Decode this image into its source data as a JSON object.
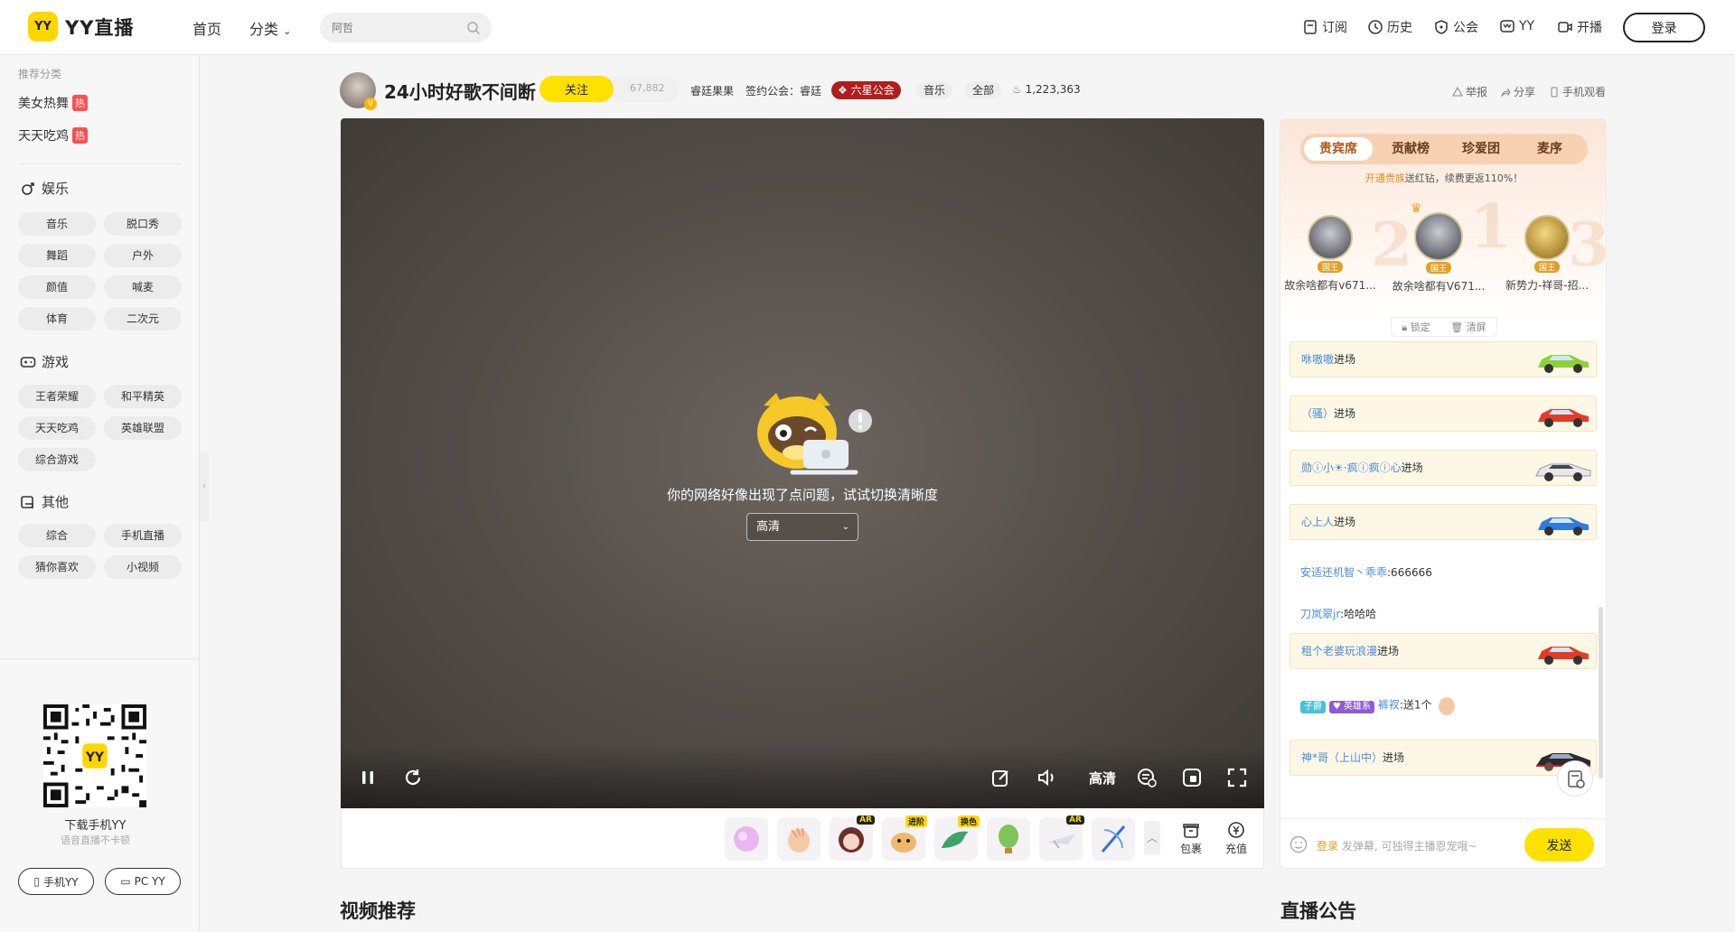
{
  "header": {
    "logo_badge": "YY",
    "logo_text": "YY直播",
    "nav": [
      "首页",
      "分类"
    ],
    "search_placeholder": "阿哲",
    "right_nav": [
      "订阅",
      "历史",
      "公会",
      "YY",
      "开播"
    ],
    "login_label": "登录"
  },
  "sidebar": {
    "recommend_title": "推荐分类",
    "hot_items": [
      {
        "label": "美女热舞",
        "badge": "热"
      },
      {
        "label": "天天吃鸡",
        "badge": "热"
      }
    ],
    "sections": [
      {
        "title": "娱乐",
        "icon": "female-symbol-icon",
        "items": [
          "音乐",
          "脱口秀",
          "舞蹈",
          "户外",
          "颜值",
          "喊麦",
          "体育",
          "二次元"
        ]
      },
      {
        "title": "游戏",
        "icon": "gamepad-icon",
        "items": [
          "王者荣耀",
          "和平精英",
          "天天吃鸡",
          "英雄联盟",
          "综合游戏"
        ]
      },
      {
        "title": "其他",
        "icon": "other-icon",
        "items": [
          "综合",
          "手机直播",
          "猜你喜欢",
          "小视频"
        ]
      }
    ],
    "download_title": "下载手机YY",
    "download_subtitle": "语音直播不卡顿",
    "app_buttons": [
      "手机YY",
      "PC YY"
    ],
    "qr_badge": "YY"
  },
  "room": {
    "title": "24小时好歌不间断",
    "follow_label": "关注",
    "followers": "67,882",
    "host_name": "睿廷果果",
    "guild_label": "签约公会：睿廷",
    "guild_badge": "六星公会",
    "tags": [
      "音乐",
      "全部"
    ],
    "heat": "1,223,363",
    "utils": [
      "举报",
      "分享",
      "手机观看"
    ]
  },
  "player": {
    "error_message": "你的网络好像出现了点问题，试试切换清晰度",
    "quality_value": "高清",
    "quality_label": "高清"
  },
  "giftbar": {
    "gifts": [
      {
        "name": "gift-1",
        "tag": ""
      },
      {
        "name": "gift-2",
        "tag": ""
      },
      {
        "name": "gift-3",
        "tag": "AR"
      },
      {
        "name": "gift-4",
        "tag": "进阶"
      },
      {
        "name": "gift-5",
        "tag": "换色"
      },
      {
        "name": "gift-6",
        "tag": ""
      },
      {
        "name": "gift-7",
        "tag": "AR"
      },
      {
        "name": "gift-8",
        "tag": ""
      }
    ],
    "bag_label": "包裹",
    "recharge_label": "充值"
  },
  "sections_below": {
    "video_recommend": "视频推荐",
    "announcement": "直播公告"
  },
  "right_panel": {
    "tabs": [
      "贵宾席",
      "贡献榜",
      "珍爱团",
      "麦序"
    ],
    "notice_highlight": "开通贵族",
    "notice_text": "送红钻，续费更返110%！",
    "top_users": [
      {
        "rank": "2",
        "name": "故余啥都有v671...",
        "tag": "国王"
      },
      {
        "rank": "1",
        "name": "故余啥都有V671...",
        "tag": "国王"
      },
      {
        "rank": "3",
        "name": "新势力-祥哥-招...",
        "tag": "国王"
      }
    ],
    "lock_label": "锁定",
    "clear_label": "清屏",
    "chat": [
      {
        "type": "entry",
        "user": "咻嗷嗷",
        "text": "进场",
        "car": "green"
      },
      {
        "type": "entry",
        "user": "（骚）",
        "text": "进场",
        "car": "red"
      },
      {
        "type": "entry",
        "user": "勋ⓘ小☀·疯ⓘ疯ⓘ心",
        "text": "进场",
        "car": "white"
      },
      {
        "type": "entry",
        "user": "心上人",
        "text": "进场",
        "car": "blue"
      },
      {
        "type": "line",
        "user": "安适还机智丶乖乖",
        "text": ":666666"
      },
      {
        "type": "line",
        "user": "刀岚翠jr",
        "text": ":哈哈哈"
      },
      {
        "type": "entry",
        "user": "租个老婆玩浪漫",
        "text": "进场",
        "car": "red"
      },
      {
        "type": "gift",
        "badge1": "子爵",
        "badge2": "英雄系",
        "user": "裤衩",
        "text": ":送1个"
      },
      {
        "type": "entry",
        "user": "神*哥（上山中）",
        "text": "进场",
        "car": "black"
      }
    ],
    "input_login": "登录",
    "input_hint": "发弹幕, 可独得主播恩宠哦~",
    "send_label": "发送"
  }
}
